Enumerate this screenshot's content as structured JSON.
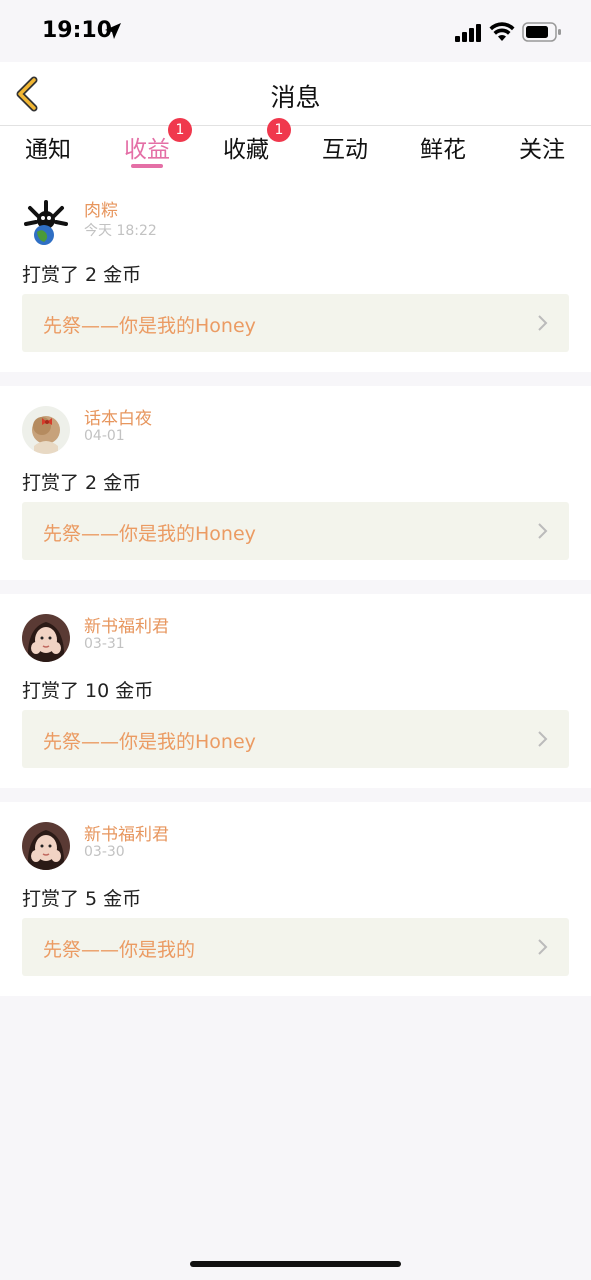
{
  "status_bar": {
    "time": "19:10"
  },
  "nav": {
    "title": "消息",
    "back_icon": "chevron-left-icon"
  },
  "tabs": [
    {
      "label": "通知",
      "active": false,
      "badge": ""
    },
    {
      "label": "收益",
      "active": true,
      "badge": "1"
    },
    {
      "label": "收藏",
      "active": false,
      "badge": "1"
    },
    {
      "label": "互动",
      "active": false,
      "badge": ""
    },
    {
      "label": "鲜花",
      "active": false,
      "badge": ""
    },
    {
      "label": "关注",
      "active": false,
      "badge": ""
    }
  ],
  "messages": [
    {
      "user": "肉粽",
      "time": "今天 18:22",
      "text": "打赏了 2 金币",
      "book": "先祭——你是我的Honey"
    },
    {
      "user": "话本白夜",
      "time": "04-01",
      "text": "打赏了 2 金币",
      "book": "先祭——你是我的Honey"
    },
    {
      "user": "新书福利君",
      "time": "03-31",
      "text": "打赏了 10 金币",
      "book": "先祭——你是我的Honey"
    },
    {
      "user": "新书福利君",
      "time": "03-30",
      "text": "打赏了 5 金币",
      "book": "先祭——你是我的"
    }
  ],
  "colors": {
    "accent": "#e46fa6",
    "username": "#e7965e",
    "book_link": "#eb9b63",
    "badge": "#f0384d",
    "back_arrow": "#f2b733"
  }
}
